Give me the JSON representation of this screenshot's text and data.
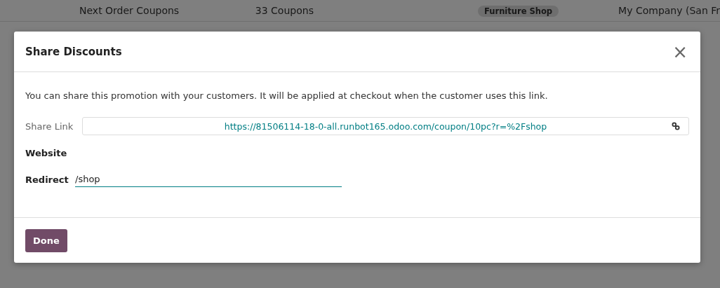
{
  "background_list": {
    "row": {
      "name": "Next Order Coupons",
      "count": "33 Coupons",
      "tag": "Furniture Shop",
      "company": "My Company (San Fr"
    }
  },
  "dialog": {
    "title": "Share Discounts",
    "close": "×",
    "description": "You can share this promotion with your customers. It will be applied at checkout when the customer uses this link.",
    "share_link": {
      "label": "Share Link",
      "value": "https://81506114-18-0-all.runbot165.odoo.com/coupon/10pc?r=%2Fshop"
    },
    "website": {
      "label": "Website"
    },
    "redirect": {
      "label": "Redirect",
      "value": "/shop"
    },
    "buttons": [
      "Done"
    ]
  }
}
